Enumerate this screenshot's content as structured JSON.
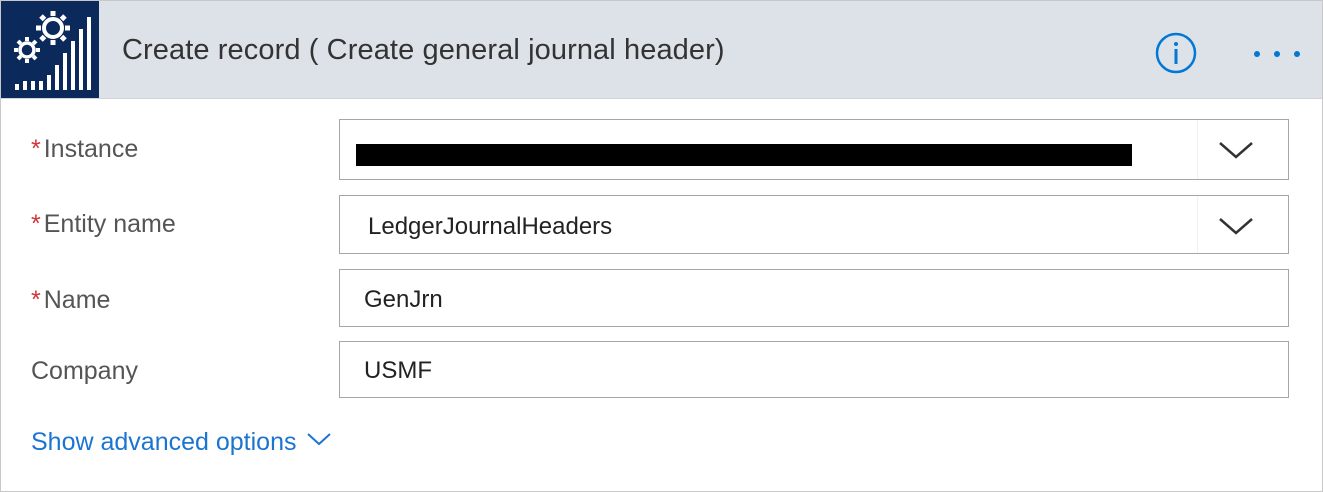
{
  "header": {
    "title": "Create record ( Create general journal header)",
    "logo_icon": "gears-bar-chart-icon",
    "info_icon": "info-icon",
    "more_icon": "more-options-icon",
    "accent_color": "#0078d4",
    "logo_bg_color": "#0b2a5b"
  },
  "fields": {
    "instance": {
      "required": "*",
      "label": "Instance",
      "value": ""
    },
    "entity_name": {
      "required": "*",
      "label": "Entity name",
      "value": "LedgerJournalHeaders"
    },
    "name": {
      "required": "*",
      "label": "Name",
      "value": "GenJrn"
    },
    "company": {
      "label": "Company",
      "value": "USMF"
    }
  },
  "advanced": {
    "label": "Show advanced options"
  }
}
